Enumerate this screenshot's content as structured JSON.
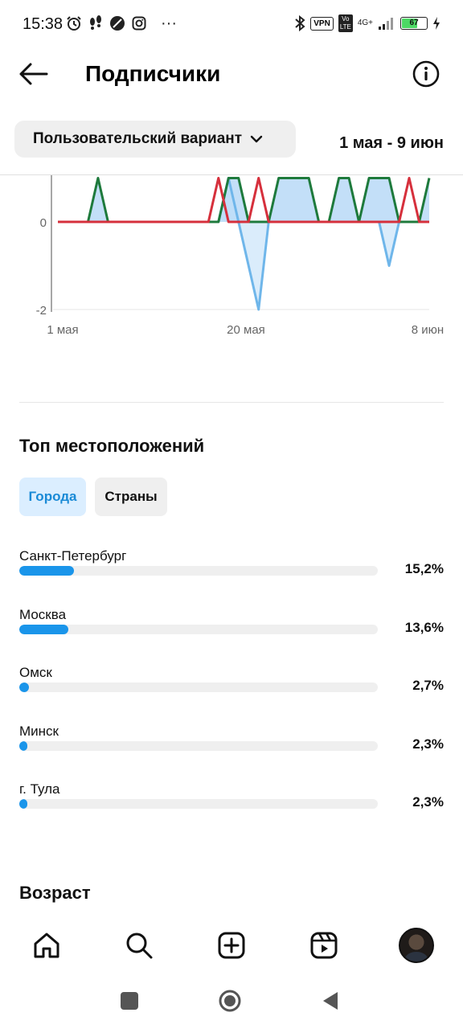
{
  "status_bar": {
    "time": "15:38",
    "left_icons": [
      "alarm-icon",
      "footsteps-icon",
      "leaf-icon",
      "instagram-icon",
      "more-dots-icon"
    ],
    "more_label": "···",
    "vpn_label": "VPN",
    "volte_label": "Vo LTE",
    "network_label": "4G+",
    "battery_level": 67,
    "battery_label": "67"
  },
  "header": {
    "title": "Подписчики",
    "back_icon": "arrow-left-icon",
    "info_icon": "info-circle-icon"
  },
  "filter": {
    "dropdown_label": "Пользовательский вариант",
    "date_range": "1 мая - 9 июн"
  },
  "chart_data": {
    "type": "line",
    "x_tick_labels": [
      "1 мая",
      "20 мая",
      "8 июн"
    ],
    "y_tick_labels": [
      "0",
      "-2"
    ],
    "y_ticks": [
      0,
      -2
    ],
    "ylim": [
      -2,
      1
    ],
    "grid": true,
    "colors": {
      "green": "#1e7a3c",
      "red": "#d6303c",
      "blue": "#6fb6ea",
      "fill": "#bcdcf7"
    },
    "series": [
      {
        "color": "green",
        "points": [
          [
            0,
            0
          ],
          [
            3,
            0
          ],
          [
            4,
            1
          ],
          [
            5,
            0
          ],
          [
            16,
            0
          ],
          [
            17,
            1
          ],
          [
            18,
            1
          ],
          [
            19,
            0
          ],
          [
            21,
            0
          ],
          [
            22,
            1
          ],
          [
            25,
            1
          ],
          [
            26,
            0
          ],
          [
            27,
            0
          ],
          [
            28,
            1
          ],
          [
            29,
            1
          ],
          [
            30,
            0
          ],
          [
            31,
            1
          ],
          [
            33,
            1
          ],
          [
            34,
            0
          ],
          [
            36,
            0
          ],
          [
            37,
            1
          ]
        ]
      },
      {
        "color": "red",
        "points": [
          [
            0,
            0
          ],
          [
            15,
            0
          ],
          [
            16,
            1
          ],
          [
            17,
            0
          ],
          [
            19,
            0
          ],
          [
            20,
            1
          ],
          [
            21,
            0
          ],
          [
            34,
            0
          ],
          [
            35,
            1
          ],
          [
            36,
            0
          ],
          [
            37,
            0
          ]
        ]
      },
      {
        "color": "blue",
        "points": [
          [
            0,
            0
          ],
          [
            15,
            0
          ],
          [
            16,
            0
          ],
          [
            17,
            1
          ],
          [
            18,
            0
          ],
          [
            20,
            -2
          ],
          [
            21,
            0
          ],
          [
            32,
            0
          ],
          [
            33,
            -1
          ],
          [
            34,
            0
          ],
          [
            37,
            0
          ]
        ]
      }
    ]
  },
  "locations": {
    "title": "Топ местоположений",
    "tabs": [
      {
        "label": "Города",
        "active": true
      },
      {
        "label": "Страны",
        "active": false
      }
    ],
    "items": [
      {
        "name": "Санкт-Петербург",
        "percent_label": "15,2%",
        "value": 15.2
      },
      {
        "name": "Москва",
        "percent_label": "13,6%",
        "value": 13.6
      },
      {
        "name": "Омск",
        "percent_label": "2,7%",
        "value": 2.7
      },
      {
        "name": "Минск",
        "percent_label": "2,3%",
        "value": 2.3
      },
      {
        "name": "г. Тула",
        "percent_label": "2,3%",
        "value": 2.3
      }
    ],
    "bar_color": "#1a95ea"
  },
  "age": {
    "title": "Возраст"
  },
  "bottom_nav": {
    "items": [
      "home-icon",
      "search-icon",
      "create-post-icon",
      "reels-icon",
      "profile-avatar"
    ]
  },
  "system_nav": {
    "items": [
      "recent-apps-icon",
      "home-circle-icon",
      "back-triangle-icon"
    ]
  }
}
